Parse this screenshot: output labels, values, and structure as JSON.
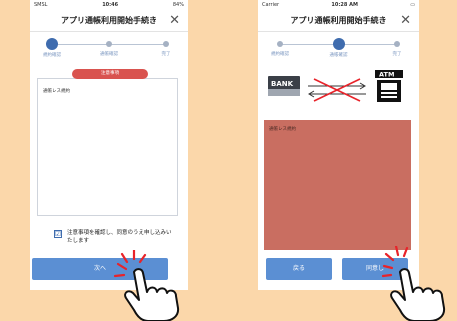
{
  "left_screen": {
    "status": {
      "carrier": "SMSL",
      "time": "10:46",
      "battery": "84%"
    },
    "title": "アプリ通帳利用開始手続き",
    "close_icon": "close-icon",
    "steps": [
      {
        "label": "規約確認",
        "active": true
      },
      {
        "label": "通帳確認",
        "active": false
      },
      {
        "label": "完了",
        "active": false
      }
    ],
    "notice_label": "注意事項",
    "terms_header": "通帳レス規約",
    "agree_checkbox_mark": "☑",
    "agree_text": "注意事項を確認し、同意のうえ申し込みいたします",
    "next_button": "次へ"
  },
  "right_screen": {
    "status": {
      "carrier": "Carrier",
      "time": "10:28 AM"
    },
    "title": "アプリ通帳利用開始手続き",
    "close_icon": "close-icon",
    "steps": [
      {
        "label": "規約確認",
        "active": false
      },
      {
        "label": "通帳確認",
        "active": true
      },
      {
        "label": "完了",
        "active": false
      }
    ],
    "bank_label": "BANK",
    "atm_label": "ATM",
    "terms_header": "通帳レス規約",
    "back_button": "戻る",
    "agree_button": "同意し"
  },
  "colors": {
    "background": "#fbd7aa",
    "accent_blue": "#3f6cae",
    "button_blue": "#5b8fd3",
    "notice_red": "#d9534f",
    "highlight_red": "#c96e61",
    "tap_burst": "#e8232a"
  }
}
